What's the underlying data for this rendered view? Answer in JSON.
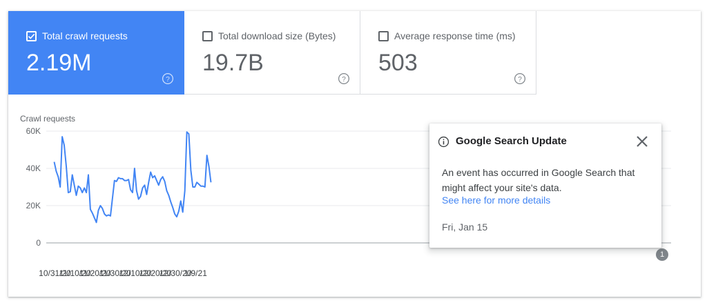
{
  "metrics": [
    {
      "label": "Total crawl requests",
      "value": "2.19M",
      "checked": true
    },
    {
      "label": "Total download size (Bytes)",
      "value": "19.7B",
      "checked": false
    },
    {
      "label": "Average response time (ms)",
      "value": "503",
      "checked": false
    }
  ],
  "chart_data": {
    "type": "line",
    "ylabel": "Crawl requests",
    "ylim": [
      0,
      60000
    ],
    "y_ticks": [
      "60K",
      "40K",
      "20K",
      "0"
    ],
    "y_tick_values": [
      60000,
      40000,
      20000,
      0
    ],
    "x_ticks": [
      "10/31/20",
      "11/10/20",
      "11/20/20",
      "11/30/20",
      "12/10/20",
      "12/20/20",
      "12/30/20",
      "1/9/21"
    ],
    "x": [
      "10/31/20",
      "11/1/20",
      "11/2/20",
      "11/3/20",
      "11/4/20",
      "11/5/20",
      "11/6/20",
      "11/7/20",
      "11/8/20",
      "11/9/20",
      "11/10/20",
      "11/11/20",
      "11/12/20",
      "11/13/20",
      "11/14/20",
      "11/15/20",
      "11/16/20",
      "11/17/20",
      "11/18/20",
      "11/19/20",
      "11/20/20",
      "11/21/20",
      "11/22/20",
      "11/23/20",
      "11/24/20",
      "11/25/20",
      "11/26/20",
      "11/27/20",
      "11/28/20",
      "11/29/20",
      "11/30/20",
      "12/1/20",
      "12/2/20",
      "12/3/20",
      "12/4/20",
      "12/5/20",
      "12/6/20",
      "12/7/20",
      "12/8/20",
      "12/9/20",
      "12/10/20",
      "12/11/20",
      "12/12/20",
      "12/13/20",
      "12/14/20",
      "12/15/20",
      "12/16/20",
      "12/17/20",
      "12/18/20",
      "12/19/20",
      "12/20/20",
      "12/21/20",
      "12/22/20",
      "12/23/20",
      "12/24/20",
      "12/25/20",
      "12/26/20",
      "12/27/20",
      "12/28/20",
      "12/29/20",
      "12/30/20",
      "12/31/20",
      "1/1/21",
      "1/2/21",
      "1/3/21",
      "1/4/21",
      "1/5/21",
      "1/6/21",
      "1/7/21",
      "1/8/21",
      "1/9/21",
      "1/10/21",
      "1/11/21",
      "1/12/21",
      "1/13/21",
      "1/14/21",
      "1/15/21",
      "1/16/21",
      "1/17/21"
    ],
    "series": [
      {
        "values": [
          43500,
          38500,
          35500,
          30000,
          57000,
          52500,
          41000,
          27000,
          27500,
          36500,
          31000,
          25500,
          30500,
          29500,
          27000,
          29500,
          27000,
          36500,
          18000,
          16000,
          13500,
          11000,
          17500,
          20000,
          18500,
          15500,
          14500,
          15000,
          14500,
          24000,
          33500,
          33000,
          35000,
          34500,
          34500,
          33500,
          33500,
          34000,
          28500,
          27000,
          40000,
          28000,
          23500,
          25000,
          29500,
          31000,
          26000,
          32500,
          38000,
          35000,
          36000,
          33500,
          31000,
          34000,
          35500,
          33000,
          28000,
          25500,
          22000,
          19000,
          15500,
          14000,
          17000,
          22500,
          16500,
          28000,
          59500,
          58500,
          39000,
          30000,
          30000,
          32500,
          31500,
          30500,
          30500,
          30000,
          47000,
          41000,
          32500
        ]
      }
    ],
    "color": "#4285f4"
  },
  "popup": {
    "title": "Google Search Update",
    "body": "An event has occurred in Google Search that might affect your site's data.",
    "link": "See here for more details",
    "date": "Fri, Jan 15"
  },
  "event_marker": "1",
  "colors": {
    "accent": "#4285f4",
    "muted": "#5f6368"
  }
}
